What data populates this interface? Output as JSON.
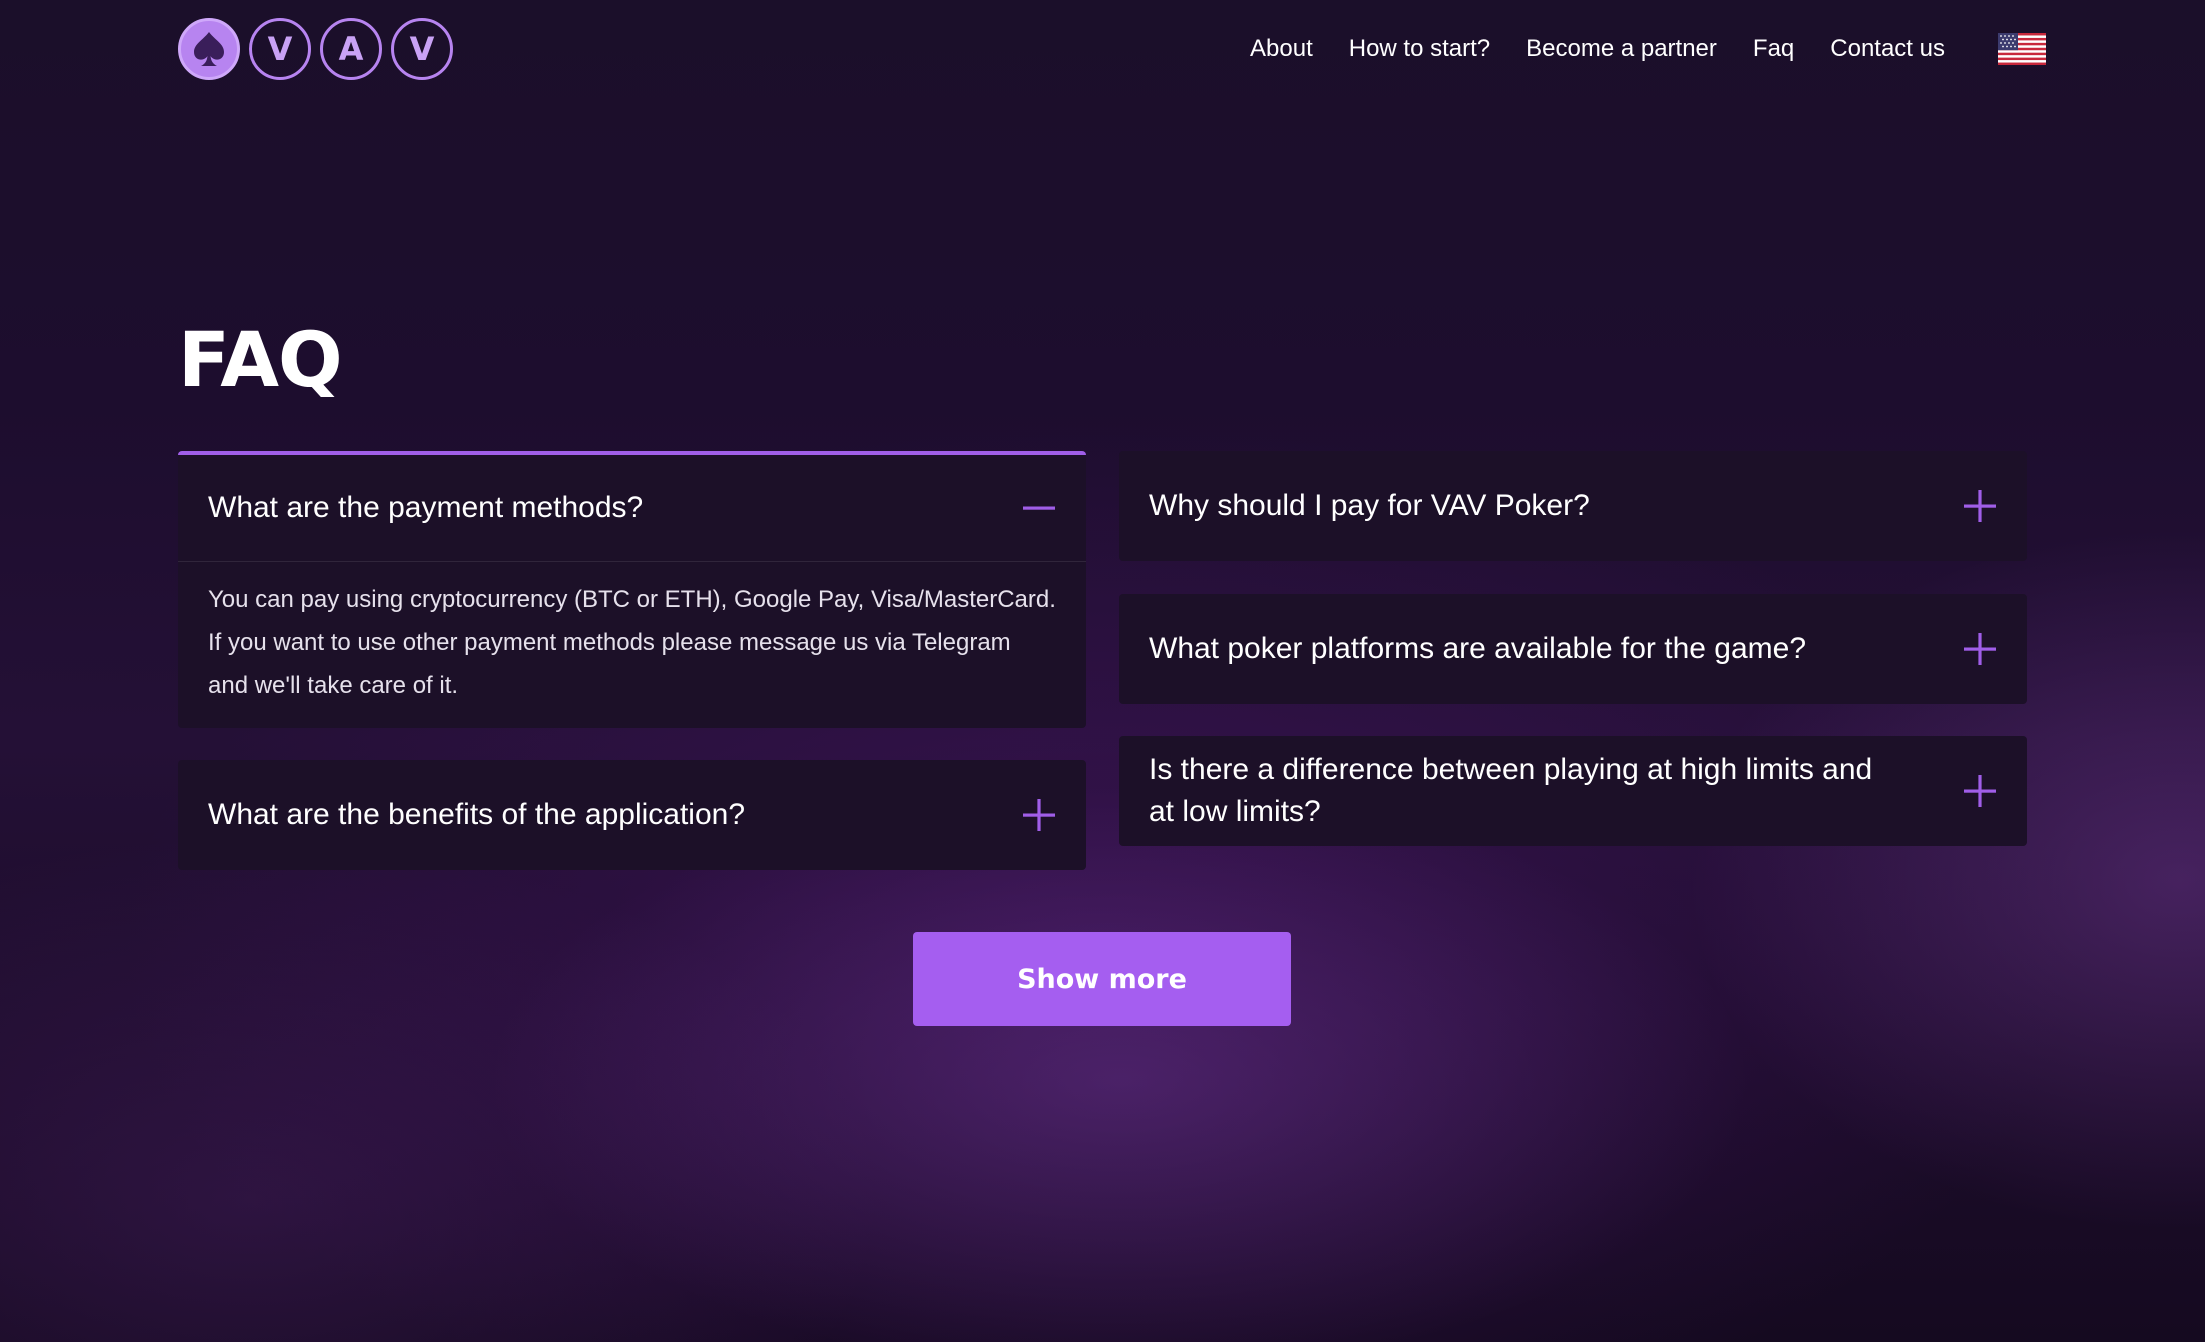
{
  "logo": {
    "icon": "spade-icon",
    "letters": [
      "V",
      "A",
      "V"
    ]
  },
  "nav": {
    "items": [
      "About",
      "How to start?",
      "Become a partner",
      "Faq",
      "Contact us"
    ],
    "language_icon": "us-flag-icon"
  },
  "faq": {
    "title": "FAQ",
    "items": [
      {
        "question": "What are the payment methods?",
        "expanded": true,
        "answer": "You can pay using cryptocurrency (BTC or ETH), Google Pay, Visa/MasterCard. If you want to use other payment methods please message us via Telegram and we'll take care of it.",
        "toggle_icon": "minus-icon"
      },
      {
        "question": "What are the benefits of the application?",
        "expanded": false,
        "toggle_icon": "plus-icon"
      },
      {
        "question": "Why should I pay for VAV Poker?",
        "expanded": false,
        "toggle_icon": "plus-icon"
      },
      {
        "question": "What poker platforms are available for the game?",
        "expanded": false,
        "toggle_icon": "plus-icon"
      },
      {
        "question": "Is there a difference between playing at high limits and at low limits?",
        "expanded": false,
        "toggle_icon": "plus-icon"
      }
    ],
    "show_more_label": "Show more"
  },
  "colors": {
    "accent": "#a55ef0",
    "background": "#1d0d2e",
    "card": "#1c1028"
  }
}
